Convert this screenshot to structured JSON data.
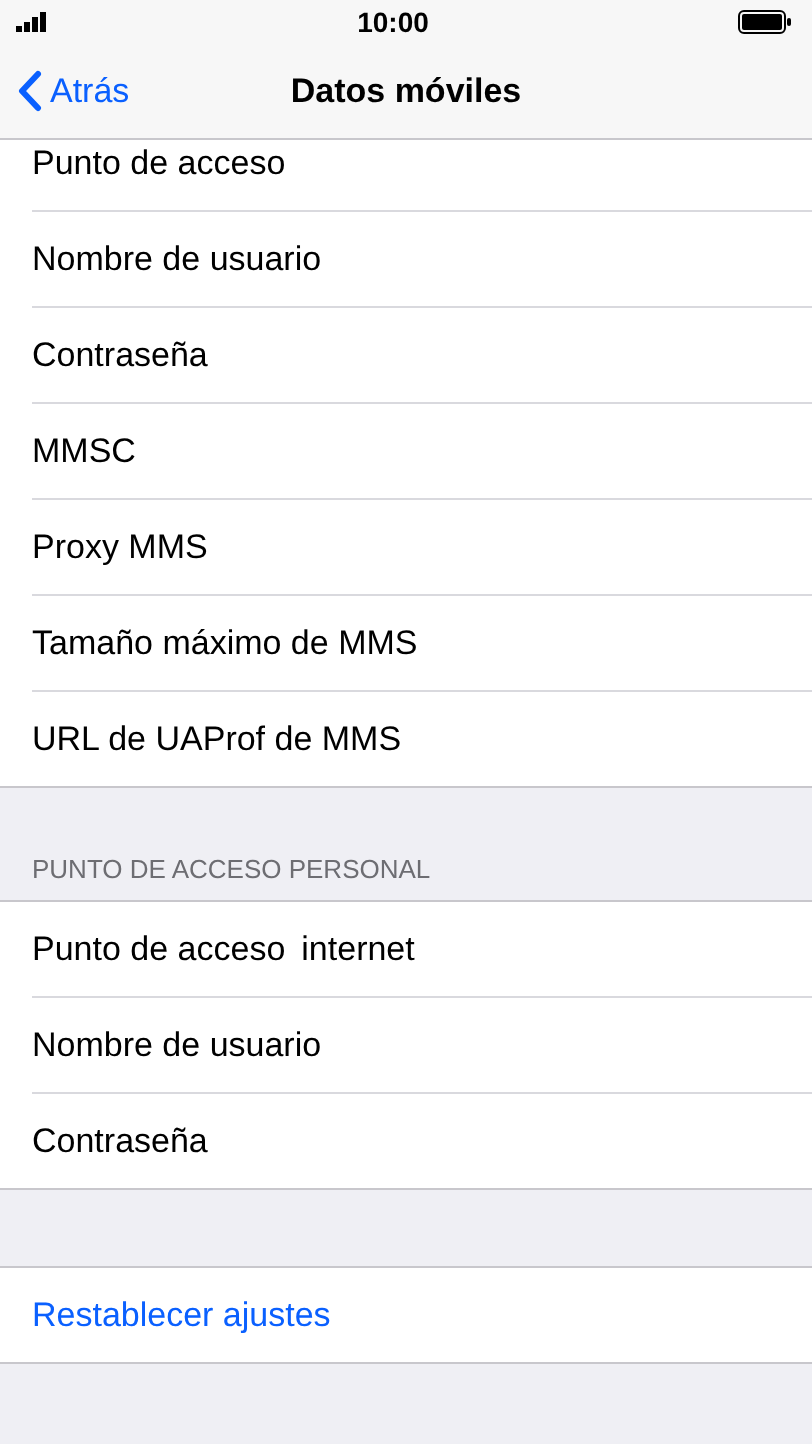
{
  "status_bar": {
    "time": "10:00"
  },
  "nav": {
    "back": "Atrás",
    "title": "Datos móviles"
  },
  "sections": [
    {
      "rows": [
        {
          "label": "Punto de acceso"
        },
        {
          "label": "Nombre de usuario"
        },
        {
          "label": "Contraseña"
        },
        {
          "label": "MMSC"
        },
        {
          "label": "Proxy MMS"
        },
        {
          "label": "Tamaño máximo de MMS"
        },
        {
          "label": "URL de UAProf de MMS"
        }
      ]
    },
    {
      "header": "PUNTO DE ACCESO PERSONAL",
      "rows": [
        {
          "label": "Punto de acceso",
          "value": "internet"
        },
        {
          "label": "Nombre de usuario"
        },
        {
          "label": "Contraseña"
        }
      ]
    }
  ],
  "reset_button": "Restablecer ajustes"
}
